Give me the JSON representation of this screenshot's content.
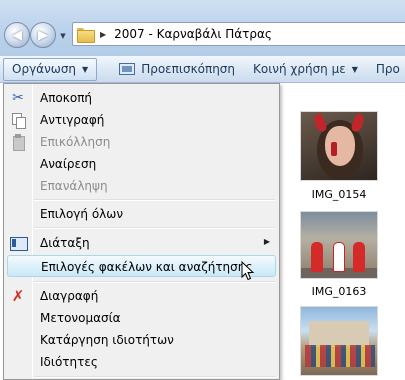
{
  "address_bar": {
    "path": "2007 - Καρναβάλι Πάτρας"
  },
  "toolbar": {
    "organize": "Οργάνωση",
    "preview": "Προεπισκόπηση",
    "share": "Κοινή χρήση με",
    "more": "Προ"
  },
  "menu": {
    "items": [
      {
        "label": "Αποκοπή",
        "icon": "scissors-icon",
        "enabled": true
      },
      {
        "label": "Αντιγραφή",
        "icon": "copy-icon",
        "enabled": true
      },
      {
        "label": "Επικόλληση",
        "icon": "paste-icon",
        "enabled": false
      },
      {
        "label": "Αναίρεση",
        "enabled": true
      },
      {
        "label": "Επανάληψη",
        "enabled": false
      },
      {
        "label": "Επιλογή όλων",
        "enabled": true
      },
      {
        "label": "Διάταξη",
        "icon": "layout-icon",
        "enabled": true,
        "submenu": true
      },
      {
        "label": "Επιλογές φακέλων και αναζήτησης",
        "enabled": true,
        "highlighted": true
      },
      {
        "label": "Διαγραφή",
        "icon": "delete-icon",
        "enabled": true
      },
      {
        "label": "Μετονομασία",
        "enabled": true
      },
      {
        "label": "Κατάργηση ιδιοτήτων",
        "enabled": true
      },
      {
        "label": "Ιδιότητες",
        "enabled": true
      }
    ]
  },
  "files": [
    {
      "name": "IMG_0154"
    },
    {
      "name": "IMG_0163"
    }
  ]
}
